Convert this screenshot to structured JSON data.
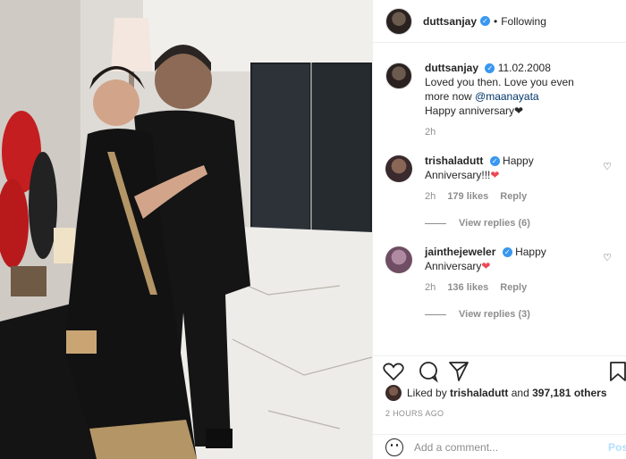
{
  "post": {
    "username": "duttsanjay",
    "follow_status": "Following",
    "separator": "•",
    "caption": {
      "date": "11.02.2008",
      "line1": "Loved you then. Love you even more now",
      "mention": "@maanayata",
      "line2": "Happy anniversary❤",
      "time": "2h"
    }
  },
  "comments": [
    {
      "username": "trishaladutt",
      "text": "Happy Anniversary!!!",
      "emoji": "❤",
      "time": "2h",
      "likes": "179 likes",
      "reply": "Reply",
      "view_replies": "View replies (6)",
      "avatar_color": "#3a2a2e"
    },
    {
      "username": "jainthejeweler",
      "text": "Happy Anniversary",
      "emoji": "❤",
      "time": "2h",
      "likes": "136 likes",
      "reply": "Reply",
      "view_replies": "View replies (3)",
      "avatar_color": "#6f4e63"
    }
  ],
  "likes_line": {
    "prefix": "Liked by",
    "user": "trishaladutt",
    "and": "and",
    "others": "397,181 others"
  },
  "timestamp": "2 HOURS AGO",
  "comment_input": {
    "placeholder": "Add a comment...",
    "post_label": "Post"
  },
  "icons": {
    "comment_heart": "heart-outline-icon",
    "like": "heart-outline-icon",
    "comment": "comment-bubble-icon",
    "share": "paper-plane-icon",
    "save": "bookmark-icon",
    "emoji": "smiley-icon",
    "verified": "verified-badge-icon"
  },
  "colors": {
    "verified_blue": "#3897f0",
    "muted_text": "#8e8e8e",
    "post_button_disabled": "#b2dffc",
    "mention": "#003569"
  }
}
